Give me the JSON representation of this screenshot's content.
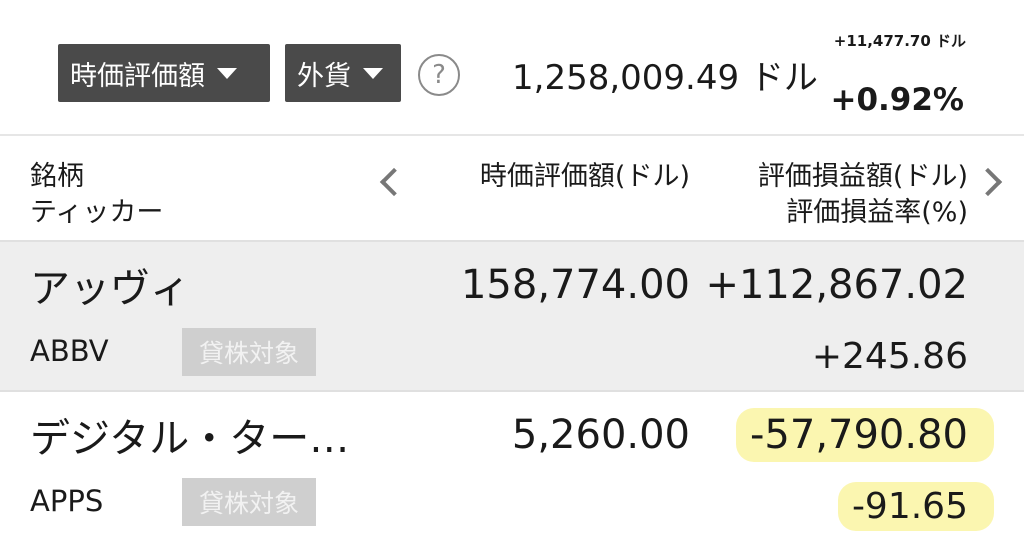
{
  "header": {
    "view_dropdown": "時価評価額",
    "currency_dropdown": "外貨",
    "help_glyph": "?",
    "total_value": "1,258,009.49 ドル",
    "change_abs": "+11,477.70 ドル",
    "change_pct": "+0.92%"
  },
  "columns": {
    "left_line1": "銘柄",
    "left_line2": "ティッカー",
    "middle": "時価評価額(ドル)",
    "right_line1": "評価損益額(ドル)",
    "right_line2": "評価損益率(%)"
  },
  "rows": [
    {
      "name": "アッヴィ",
      "ticker": "ABBV",
      "badge": "貸株対象",
      "value": "158,774.00",
      "pl": "+112,867.02",
      "pct": "+245.86"
    },
    {
      "name": "デジタル・ター…",
      "ticker": "APPS",
      "badge": "貸株対象",
      "value": "5,260.00",
      "pl": "-57,790.80",
      "pct": "-91.65"
    }
  ],
  "colors": {
    "dropdown_bg": "#4a4a4a",
    "highlight": "#fbf6b0",
    "row_alt_bg": "#eeeeee",
    "badge_bg": "#cfcfcf"
  }
}
